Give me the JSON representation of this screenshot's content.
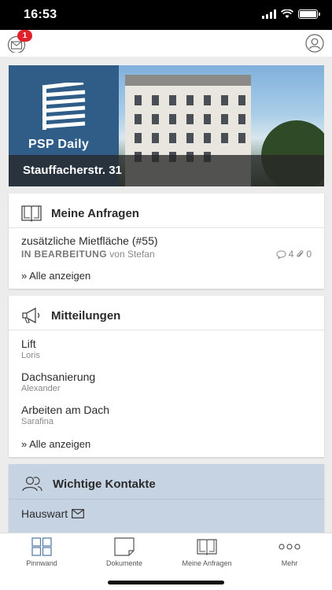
{
  "status_bar": {
    "time": "16:53"
  },
  "header": {
    "notification_count": "1"
  },
  "hero": {
    "logo_text": "PSP Daily",
    "address": "Stauffacherstr. 31"
  },
  "requests_card": {
    "title": "Meine Anfragen",
    "item": {
      "title": "zusätzliche Mietfläche (#55)",
      "status": "IN BEARBEITUNG",
      "by": "von Stefan",
      "comments": "4",
      "attachments": "0"
    },
    "show_all": "» Alle anzeigen"
  },
  "messages_card": {
    "title": "Mitteilungen",
    "items": [
      {
        "title": "Lift",
        "author": "Loris"
      },
      {
        "title": "Dachsanierung",
        "author": "Alexander"
      },
      {
        "title": "Arbeiten am Dach",
        "author": "Sarafina"
      }
    ],
    "show_all": "» Alle anzeigen"
  },
  "contacts_card": {
    "title": "Wichtige Kontakte",
    "items": [
      {
        "label": "Hauswart"
      }
    ]
  },
  "tabs": [
    {
      "label": "Pinnwand",
      "icon": "grid-icon"
    },
    {
      "label": "Dokumente",
      "icon": "document-icon"
    },
    {
      "label": "Meine Anfragen",
      "icon": "book-icon"
    },
    {
      "label": "Mehr",
      "icon": "more-icon"
    }
  ],
  "colors": {
    "brand_blue": "#2f5d88",
    "badge_red": "#e0212b",
    "contacts_bg": "#c5d3e2"
  }
}
